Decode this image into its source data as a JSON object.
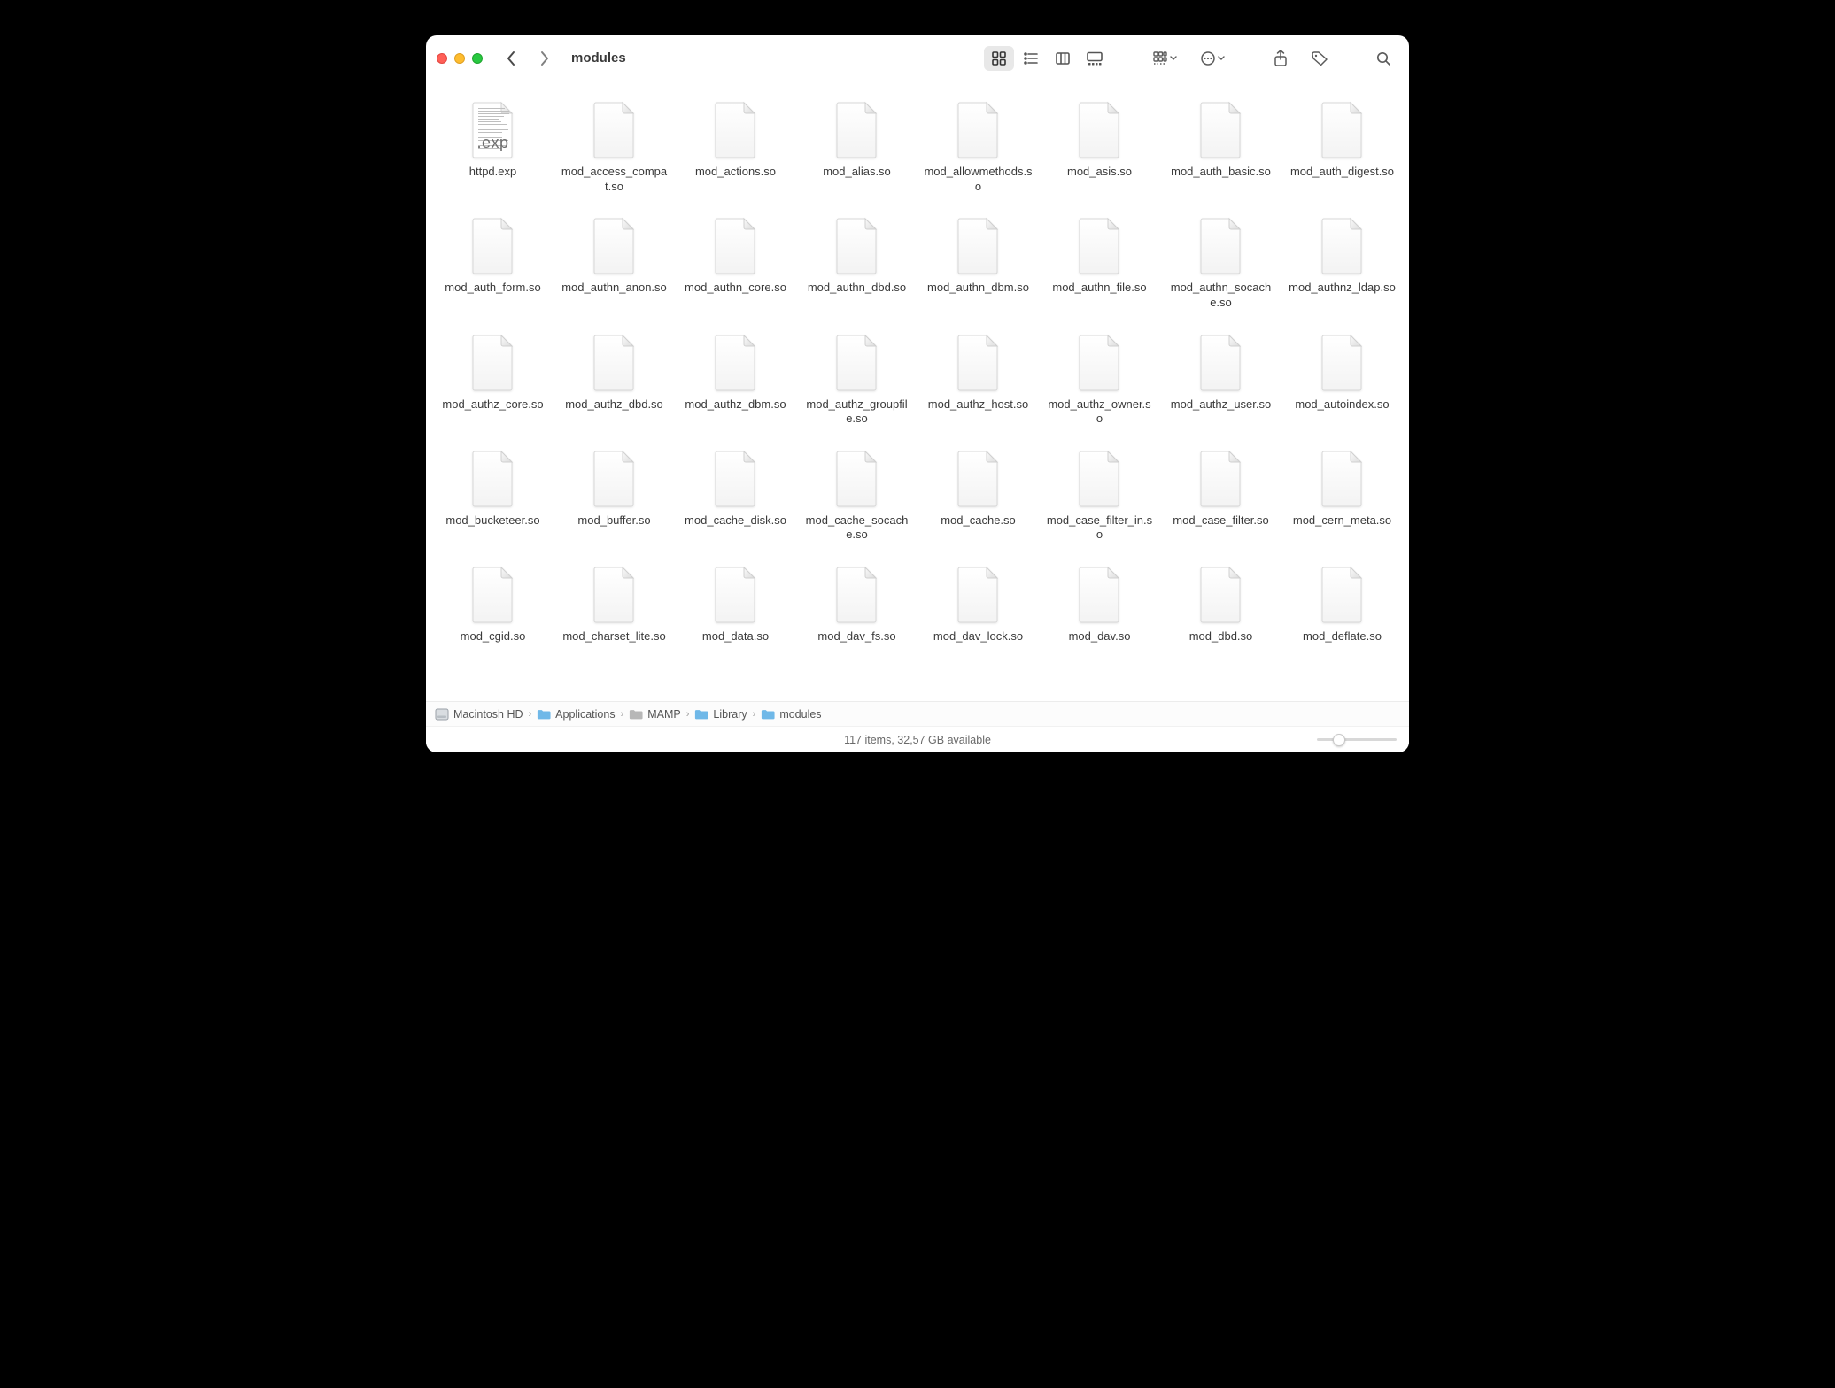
{
  "window": {
    "title": "modules"
  },
  "toolbar": {
    "nav_back_enabled": true,
    "nav_forward_enabled": false,
    "view_mode_active": "icon"
  },
  "files": [
    {
      "name": "httpd.exp",
      "badge": ".exp"
    },
    {
      "name": "mod_access_compat.so"
    },
    {
      "name": "mod_actions.so"
    },
    {
      "name": "mod_alias.so"
    },
    {
      "name": "mod_allowmethods.so"
    },
    {
      "name": "mod_asis.so"
    },
    {
      "name": "mod_auth_basic.so"
    },
    {
      "name": "mod_auth_digest.so"
    },
    {
      "name": "mod_auth_form.so"
    },
    {
      "name": "mod_authn_anon.so"
    },
    {
      "name": "mod_authn_core.so"
    },
    {
      "name": "mod_authn_dbd.so"
    },
    {
      "name": "mod_authn_dbm.so"
    },
    {
      "name": "mod_authn_file.so"
    },
    {
      "name": "mod_authn_socache.so"
    },
    {
      "name": "mod_authnz_ldap.so"
    },
    {
      "name": "mod_authz_core.so"
    },
    {
      "name": "mod_authz_dbd.so"
    },
    {
      "name": "mod_authz_dbm.so"
    },
    {
      "name": "mod_authz_groupfile.so"
    },
    {
      "name": "mod_authz_host.so"
    },
    {
      "name": "mod_authz_owner.so"
    },
    {
      "name": "mod_authz_user.so"
    },
    {
      "name": "mod_autoindex.so"
    },
    {
      "name": "mod_bucketeer.so"
    },
    {
      "name": "mod_buffer.so"
    },
    {
      "name": "mod_cache_disk.so"
    },
    {
      "name": "mod_cache_socache.so"
    },
    {
      "name": "mod_cache.so"
    },
    {
      "name": "mod_case_filter_in.so"
    },
    {
      "name": "mod_case_filter.so"
    },
    {
      "name": "mod_cern_meta.so"
    },
    {
      "name": "mod_cgid.so"
    },
    {
      "name": "mod_charset_lite.so"
    },
    {
      "name": "mod_data.so"
    },
    {
      "name": "mod_dav_fs.so"
    },
    {
      "name": "mod_dav_lock.so"
    },
    {
      "name": "mod_dav.so"
    },
    {
      "name": "mod_dbd.so"
    },
    {
      "name": "mod_deflate.so"
    }
  ],
  "path": [
    {
      "label": "Macintosh HD",
      "icon": "disk"
    },
    {
      "label": "Applications",
      "icon": "folder-blue"
    },
    {
      "label": "MAMP",
      "icon": "folder-gray"
    },
    {
      "label": "Library",
      "icon": "folder-blue"
    },
    {
      "label": "modules",
      "icon": "folder-blue"
    }
  ],
  "status": {
    "text": "117 items, 32,57 GB available"
  },
  "colors": {
    "folder_blue": "#6fb8e8",
    "folder_gray": "#b7b7b7",
    "disk": "#9aa1a8"
  }
}
